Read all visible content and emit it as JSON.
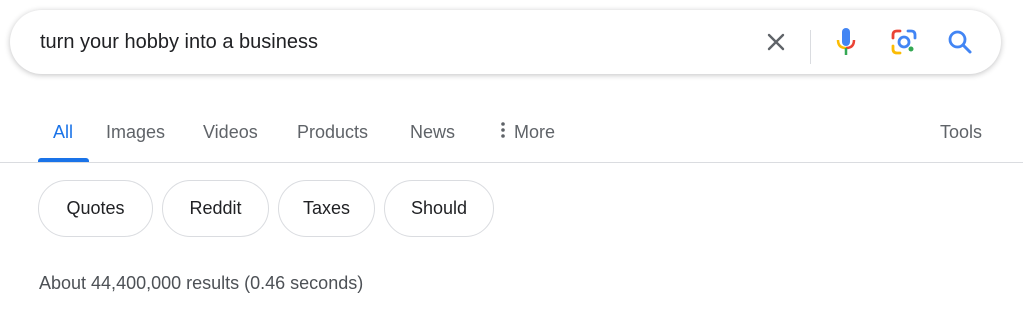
{
  "search": {
    "query": "turn your hobby into a business",
    "icons": {
      "clear": "close-icon",
      "mic": "microphone-icon",
      "lens": "camera-lens-icon",
      "search": "search-icon"
    }
  },
  "tabs": [
    {
      "label": "All",
      "active": true
    },
    {
      "label": "Images",
      "active": false
    },
    {
      "label": "Videos",
      "active": false
    },
    {
      "label": "Products",
      "active": false
    },
    {
      "label": "News",
      "active": false
    },
    {
      "label": "More",
      "active": false
    }
  ],
  "tools_label": "Tools",
  "chips": [
    "Quotes",
    "Reddit",
    "Taxes",
    "Should"
  ],
  "result_stats": "About 44,400,000 results (0.46 seconds)",
  "colors": {
    "accent": "#1a73e8",
    "tab_text": "#5f6368",
    "google_blue": "#4285f4",
    "google_red": "#ea4335",
    "google_yellow": "#fbbc04",
    "google_green": "#34a853"
  }
}
